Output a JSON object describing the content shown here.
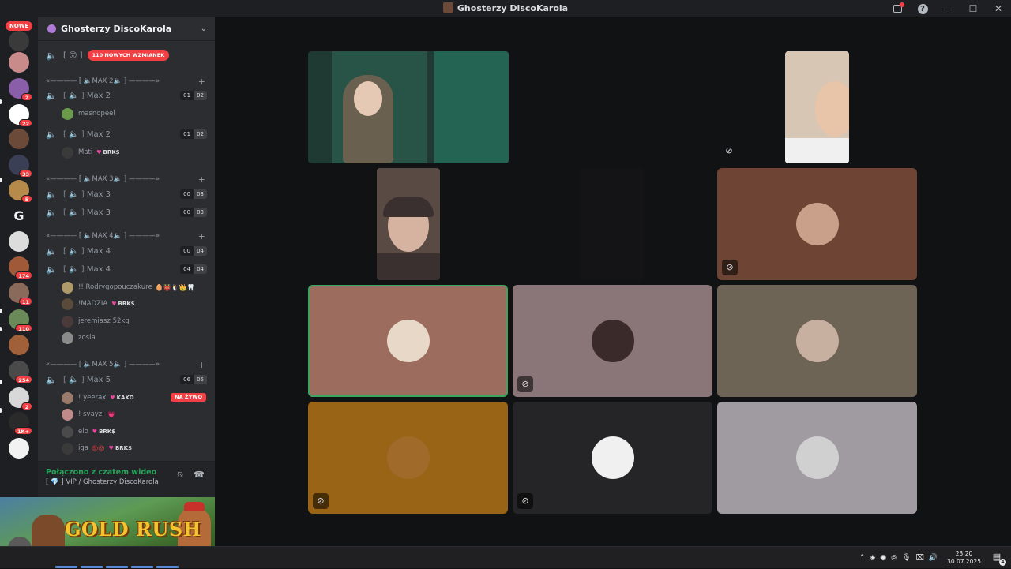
{
  "window": {
    "title": "Ghosterzy DiscoKarola",
    "controls": {
      "minimize": "—",
      "maximize": "☐",
      "close": "✕"
    },
    "help": "?"
  },
  "rail": {
    "new_label": "NOWE",
    "servers": [
      {
        "color": "#3a3a3a",
        "badge": ""
      },
      {
        "color": "#c98a8a",
        "badge": ""
      },
      {
        "color": "#8a5ea8",
        "badge": "2"
      },
      {
        "color": "#ffffff",
        "badge": "22"
      },
      {
        "color": "#6b4a3a",
        "badge": ""
      },
      {
        "color": "#3b3f55",
        "badge": "33"
      },
      {
        "color": "#b58a4a",
        "badge": "5"
      },
      {
        "color": "",
        "badge": "",
        "letter": "G"
      },
      {
        "color": "#dcdcdc",
        "badge": ""
      },
      {
        "color": "#a05a3a",
        "badge": "174"
      },
      {
        "color": "#8a6a5a",
        "badge": "11"
      },
      {
        "color": "#6a8a5a",
        "badge": "110"
      },
      {
        "color": "#a0603a",
        "badge": ""
      },
      {
        "color": "#4a4a4a",
        "badge": "254"
      },
      {
        "color": "#d8d8d8",
        "badge": "2"
      },
      {
        "color": "#2a2a2a",
        "badge": "1K+"
      },
      {
        "color": "#f2f2f2",
        "badge": ""
      }
    ]
  },
  "sidebar": {
    "guild_name": "Ghosterzy DiscoKarola",
    "top_channel": {
      "icon": "[ 😵 ]",
      "mention_label": "110 NOWYCH WZMIANEK"
    },
    "categories": [
      {
        "label": "«———— [ 🔈MAX 2🔈 ] ————»",
        "plus": "+"
      },
      {
        "label": "«———— [ 🔈MAX 3🔈 ] ————»",
        "plus": "+"
      },
      {
        "label": "«———— [ 🔈MAX 4🔈 ] ————»",
        "plus": "+"
      },
      {
        "label": "«———— [ 🔈MAX 5🔈 ] ————»",
        "plus": "+"
      }
    ],
    "channels": [
      {
        "name": "Max 2",
        "count_a": "01",
        "count_b": "02"
      },
      {
        "name": "Max 2",
        "count_a": "01",
        "count_b": "02"
      },
      {
        "name": "Max 3",
        "count_a": "00",
        "count_b": "03"
      },
      {
        "name": "Max 3",
        "count_a": "00",
        "count_b": "03"
      },
      {
        "name": "Max 4",
        "count_a": "00",
        "count_b": "04"
      },
      {
        "name": "Max 4",
        "count_a": "04",
        "count_b": "04"
      },
      {
        "name": "Max 5",
        "count_a": "06",
        "count_b": "05"
      }
    ],
    "channel_prefix": "[ 🔈 ]",
    "members": [
      {
        "name": "masnopeel",
        "tag": "",
        "emoji": "",
        "color": "#6a9a4a"
      },
      {
        "name": "Mati",
        "tag": "BRK$",
        "emoji": "",
        "color": "#3a3a3a"
      },
      {
        "name": "!! Rodrygopouczakure",
        "tag": "",
        "emoji": "🥚👹🐧👑🦷",
        "color": "#b09a6a"
      },
      {
        "name": "!MADZIA",
        "tag": "BRK$",
        "emoji": "",
        "color": "#5a4a3a"
      },
      {
        "name": "jeremiasz 52kg",
        "tag": "",
        "emoji": "",
        "color": "#4a3a3a"
      },
      {
        "name": "zosia",
        "tag": "",
        "emoji": "",
        "color": "#8a8a8a"
      },
      {
        "name": "! yeerax",
        "tag": "KAKO",
        "emoji": "",
        "color": "#9a7a6a"
      },
      {
        "name": "! svayz.",
        "tag": "",
        "emoji": "💗",
        "color": "#c08a8a"
      },
      {
        "name": "elo",
        "tag": "BRK$",
        "emoji": "",
        "color": "#4a4a4a"
      },
      {
        "name": "iga",
        "tag": "BRK$",
        "emoji": "😡😡",
        "color": "#3a3a3a"
      }
    ],
    "live_label": "NA ŻYWO",
    "voice_panel": {
      "status": "Połączono z czatem wideo",
      "channel": "[ 💎 ] VIP / Ghosterzy DiscoKarola"
    }
  },
  "game_overlay": {
    "title": "GOLD RUSH"
  },
  "stage": {
    "tiles": [
      {
        "bg": "#6e4434",
        "muted": true,
        "avatar": "#c9a08a"
      },
      {
        "bg": "#9c6d5e",
        "muted": false,
        "avatar": "#e8d8c8",
        "selected": true
      },
      {
        "bg": "#8a7678",
        "muted": true,
        "avatar": "#3a2a2a"
      },
      {
        "bg": "#6e6455",
        "muted": false,
        "avatar": "#c8b0a0"
      },
      {
        "bg": "#996416",
        "muted": true,
        "avatar": "#a06a2a"
      },
      {
        "bg": "#252527",
        "muted": true,
        "avatar": "#f0f0f0"
      },
      {
        "bg": "#a09ba0",
        "muted": false,
        "avatar": "#d0d0d0"
      }
    ],
    "cams": [
      {
        "bg": "#1f3a33"
      },
      {
        "bg": "#d8c6b4"
      },
      {
        "bg": "#5a4a44"
      }
    ],
    "mute_icon": "🎙"
  },
  "taskbar": {
    "time": "23:20",
    "date": "30.07.2025",
    "notification_count": "4"
  }
}
